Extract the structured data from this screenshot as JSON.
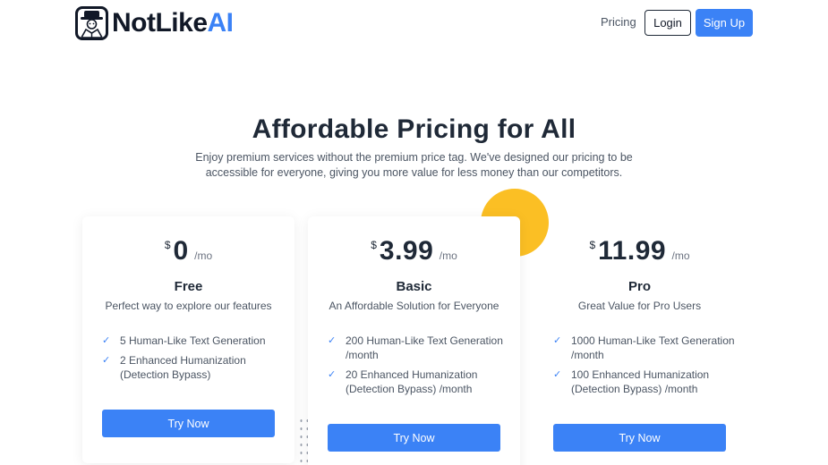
{
  "header": {
    "logo_text": "NotLike",
    "logo_accent": "AI",
    "nav_pricing": "Pricing",
    "login_label": "Login",
    "signup_label": "Sign Up"
  },
  "hero": {
    "title": "Affordable Pricing for All",
    "subtitle": "Enjoy premium services without the premium price tag. We've designed our pricing to be accessible for everyone, giving you more value for less money than our competitors."
  },
  "plans": [
    {
      "currency": "$",
      "price": "0",
      "period": "/mo",
      "name": "Free",
      "description": "Perfect way to explore our features",
      "features": [
        "5 Human-Like Text Generation",
        "2 Enhanced Humanization (Detection Bypass)"
      ],
      "cta": "Try Now"
    },
    {
      "currency": "$",
      "price": "3.99",
      "period": "/mo",
      "name": "Basic",
      "description": "An Affordable Solution for Everyone",
      "features": [
        "200 Human-Like Text Generation /month",
        "20 Enhanced Humanization (Detection Bypass) /month"
      ],
      "cta": "Try Now"
    },
    {
      "currency": "$",
      "price": "11.99",
      "period": "/mo",
      "name": "Pro",
      "description": "Great Value for Pro Users",
      "features": [
        "1000 Human-Like Text Generation /month",
        "100 Enhanced Humanization (Detection Bypass) /month"
      ],
      "cta": "Try Now"
    }
  ],
  "icons": {
    "check": "check-icon",
    "logo": "detective-logo-icon"
  },
  "colors": {
    "accent": "#3b82f6",
    "decor": "#fbbf24",
    "text": "#1f2937"
  }
}
